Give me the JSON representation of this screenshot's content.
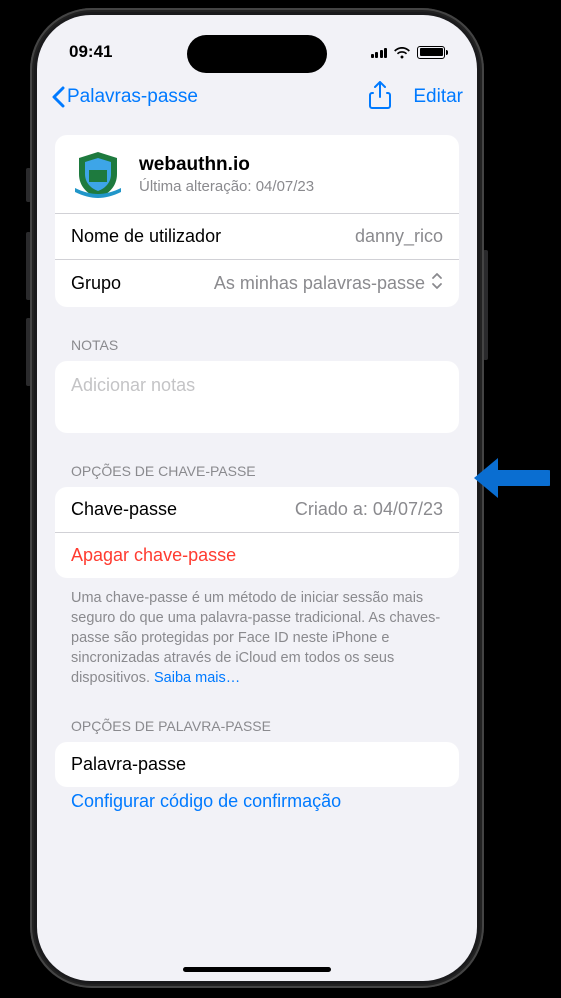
{
  "status": {
    "time": "09:41"
  },
  "nav": {
    "back_label": "Palavras-passe",
    "edit_label": "Editar"
  },
  "account": {
    "title": "webauthn.io",
    "subtitle": "Última alteração: 04/07/23",
    "username_label": "Nome de utilizador",
    "username_value": "danny_rico",
    "group_label": "Grupo",
    "group_value": "As minhas palavras-passe"
  },
  "notes": {
    "header": "NOTAS",
    "placeholder": "Adicionar notas"
  },
  "passkey": {
    "header": "OPÇÕES DE CHAVE-PASSE",
    "label": "Chave-passe",
    "created": "Criado a: 04/07/23",
    "delete_label": "Apagar chave-passe",
    "info_text": "Uma chave-passe é um método de iniciar sessão mais seguro do que uma palavra-passe tradicional. As chaves-passe são protegidas por Face ID neste iPhone e sincronizadas através de iCloud em todos os seus dispositivos. ",
    "learn_more": "Saiba mais…"
  },
  "password": {
    "header": "OPÇÕES DE PALAVRA-PASSE",
    "label": "Palavra-passe",
    "setup_label": "Configurar código de confirmação"
  }
}
